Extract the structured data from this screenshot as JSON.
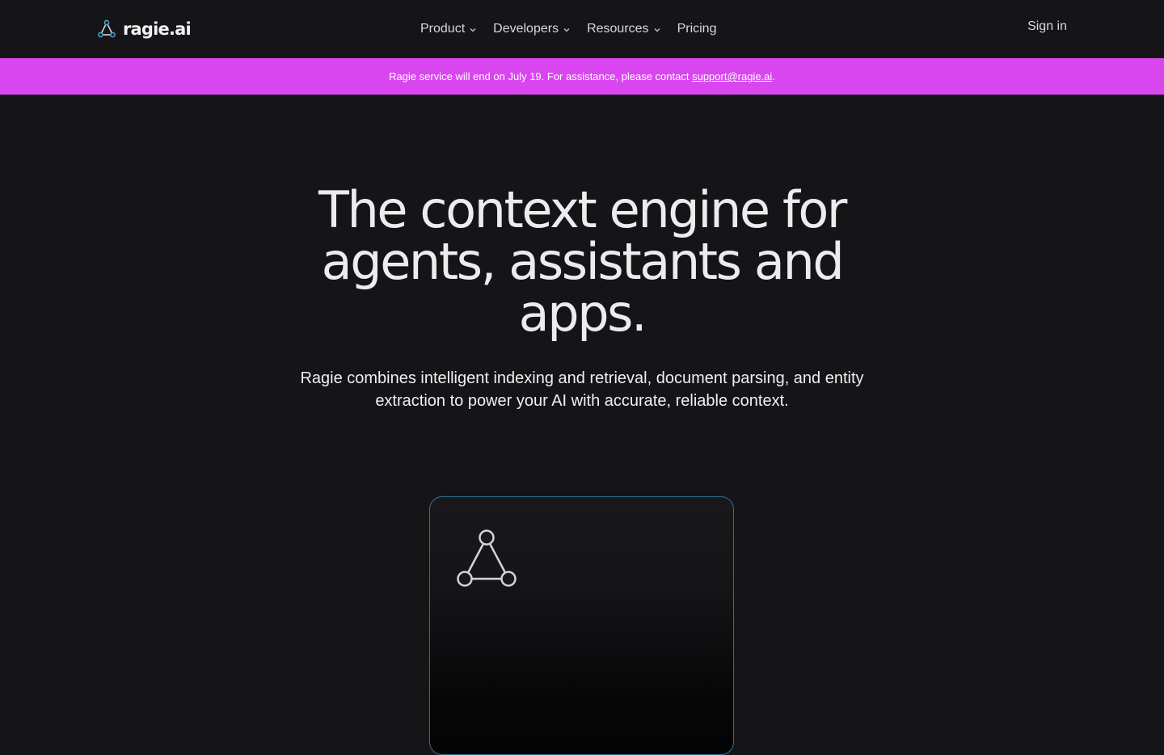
{
  "nav": {
    "brand": "ragie.ai",
    "menu": [
      {
        "label": "Product",
        "has_dropdown": true
      },
      {
        "label": "Developers",
        "has_dropdown": true
      },
      {
        "label": "Resources",
        "has_dropdown": true
      },
      {
        "label": "Pricing",
        "has_dropdown": false
      }
    ],
    "sign_in": "Sign in"
  },
  "banner": {
    "text": "Ragie service will end on July 19. For assistance, please contact ",
    "link": "support@ragie.ai",
    "suffix": "."
  },
  "hero": {
    "title_line1": "The context engine for",
    "title_line2": "agents, assistants and",
    "title_line3": "apps.",
    "subtitle_line1": "Ragie combines intelligent indexing and retrieval, document parsing, and entity",
    "subtitle_line2": "extraction to power your AI with accurate, reliable context."
  },
  "icons": {
    "logo": "triangle-nodes-icon",
    "dropdown": "chevron-down-icon",
    "card": "triangle-nodes-icon"
  },
  "colors": {
    "background": "#151517",
    "banner": "#d946ef",
    "card_border": "#2f6f96",
    "logo_gradient_start": "#2ec4a6",
    "logo_gradient_end": "#6a7cf0"
  }
}
